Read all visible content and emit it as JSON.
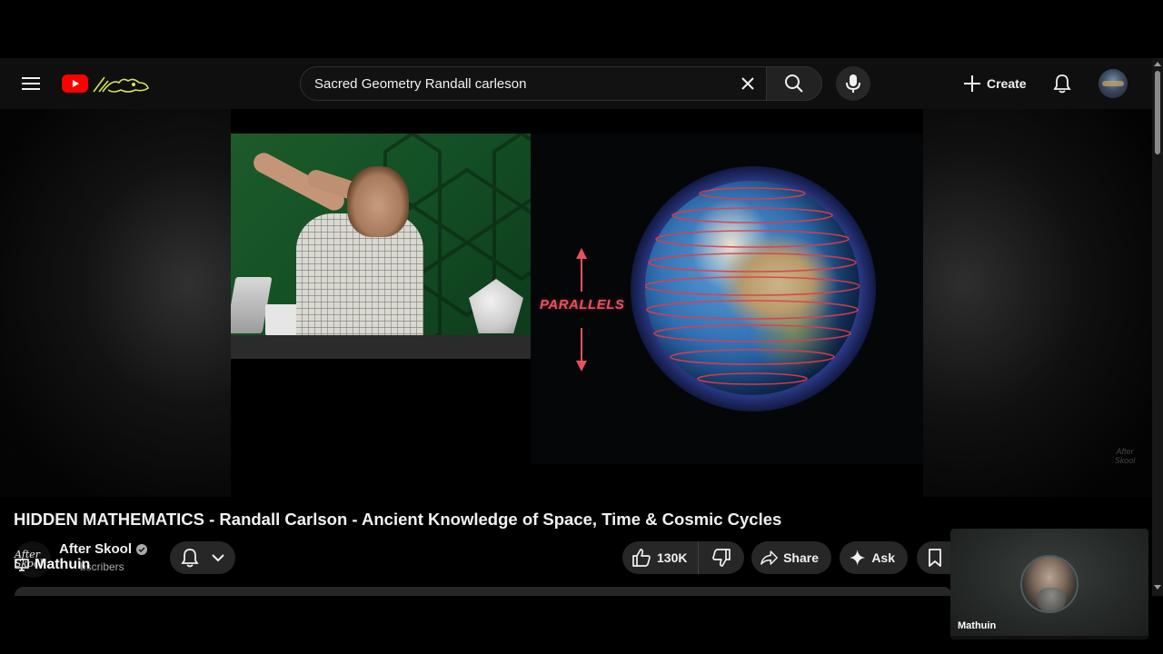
{
  "header": {
    "search_value": "Sacred Geometry Randall carleson",
    "create_label": "Create"
  },
  "video": {
    "overlay_label": "PARALLELS",
    "watermark": "After Skool",
    "title": "HIDDEN MATHEMATICS - Randall Carlson - Ancient Knowledge of Space, Time & Cosmic Cycles"
  },
  "channel": {
    "avatar_text": "After Skool",
    "name": "After Skool",
    "subscribers": "bscribers",
    "overlay_user": "Mathuin"
  },
  "actions": {
    "like_count": "130K",
    "share_label": "Share",
    "ask_label": "Ask"
  },
  "webcam": {
    "name": "Mathuin"
  },
  "colors": {
    "brand_red": "#ff0000",
    "background": "#0f0f0f",
    "parallels_red": "#e8525e"
  },
  "icons": [
    "menu-icon",
    "youtube-logo-icon",
    "clear-icon",
    "search-icon",
    "mic-icon",
    "plus-icon",
    "bell-icon",
    "verified-icon",
    "bell-subscribe-icon",
    "chevron-down-icon",
    "like-icon",
    "dislike-icon",
    "share-icon",
    "sparkle-icon",
    "save-icon",
    "monitor-icon"
  ]
}
